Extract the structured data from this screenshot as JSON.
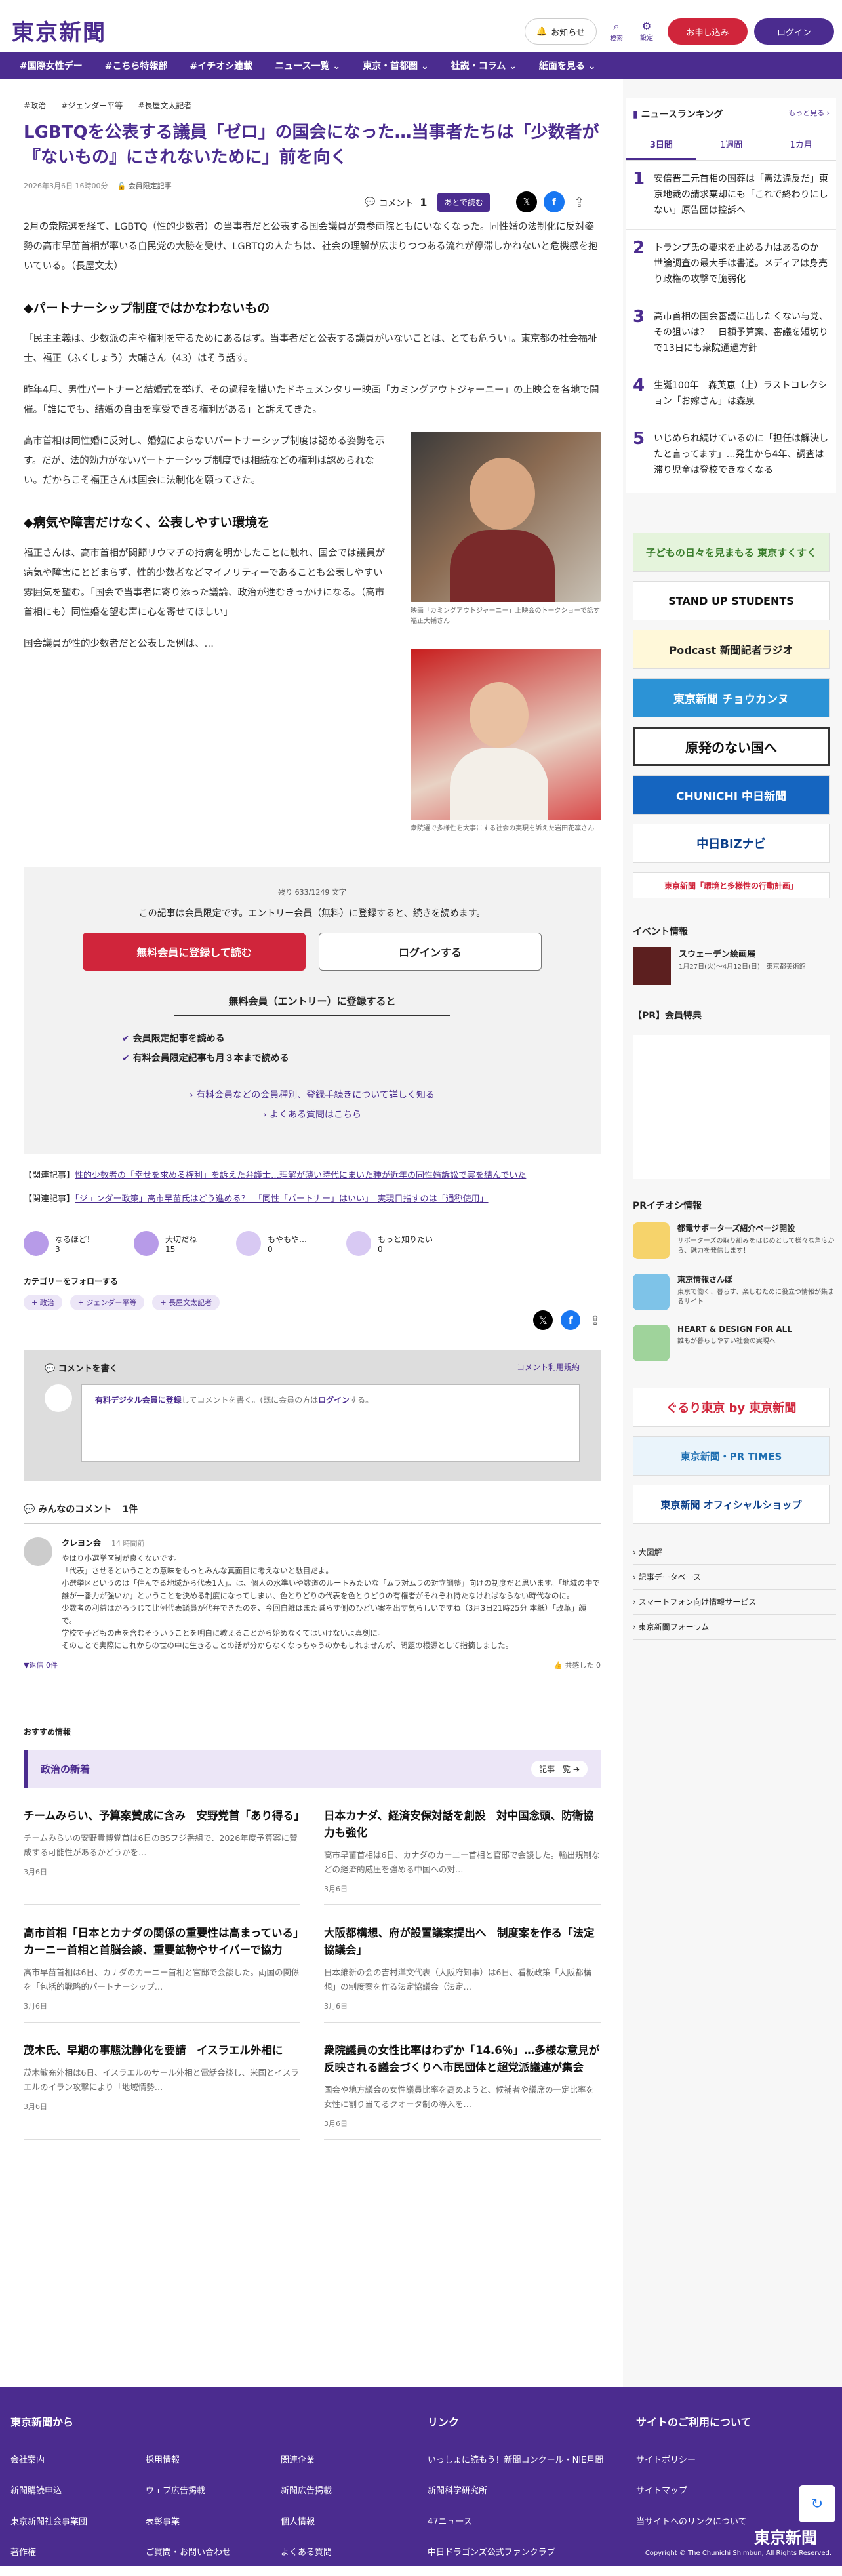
{
  "header": {
    "logo": "東京新聞",
    "notice_btn": "お知らせ",
    "search_label": "検索",
    "settings_label": "設定",
    "apply_btn": "お申し込み",
    "login_btn": "ログイン"
  },
  "nav": [
    "#国際女性デー",
    "#こちら特報部",
    "#イチオシ連載",
    "ニュース一覧 ⌄",
    "東京・首都圏 ⌄",
    "社説・コラム ⌄",
    "紙面を見る ⌄"
  ],
  "article": {
    "tags": [
      "政治",
      "ジェンダー平等",
      "長屋文太記者"
    ],
    "title": "LGBTQを公表する議員「ゼロ」の国会になった…当事者たちは「少数者が『ないもの』にされないために」前を向く",
    "date": "2026年3月6日 16時00分",
    "member_badge": "会員限定記事",
    "comment_label": "コメント",
    "comment_count": "1",
    "read_later": "あとで読む",
    "lead": "2月の衆院選を経て、LGBTQ（性的少数者）の当事者だと公表する国会議員が衆参両院ともにいなくなった。同性婚の法制化に反対姿勢の高市早苗首相が率いる自民党の大勝を受け、LGBTQの人たちは、社会の理解が広まりつつある流れが停滞しかねないと危機感を抱いている。（長屋文太）",
    "h2_1": "◆パートナーシップ制度ではかなわないもの",
    "p1": "「民主主義は、少数派の声や権利を守るためにあるはず。当事者だと公表する議員がいないことは、とても危うい」。東京都の社会福祉士、福正（ふくしょう）大輔さん（43）はそう話す。",
    "p2": "昨年4月、男性パートナーと結婚式を挙げ、その過程を描いたドキュメンタリー映画「カミングアウトジャーニー」の上映会を各地で開催。「誰にでも、結婚の自由を享受できる権利がある」と訴えてきた。",
    "p3": "高市首相は同性婚に反対し、婚姻によらないパートナーシップ制度は認める姿勢を示す。だが、法的効力がないパートナーシップ制度では相続などの権利は認められない。だからこそ福正さんは国会に法制化を願ってきた。",
    "h2_2": "◆病気や障害だけなく、公表しやすい環境を",
    "p4": "福正さんは、高市首相が関節リウマチの持病を明かしたことに触れ、国会では議員が病気や障害にとどまらず、性的少数者などマイノリティーであることも公表しやすい雰囲気を望む。「国会で当事者に寄り添った議論、政治が進むきっかけになる。（高市首相にも）同性婚を望む声に心を寄せてほしい」",
    "p5": "国会議員が性的少数者だと公表した例は、…",
    "cap1": "映画「カミングアウトジャーニー」上映会のトークショーで話す福正大輔さん",
    "cap2": "衆院選で多様性を大事にする社会の実現を訴えた岩田花凛さん",
    "remaining": "残り 633/1249 文字",
    "paywall_msg": "この記事は会員限定です。エントリー会員（無料）に登録すると、続きを読めます。",
    "register_btn": "無料会員に登録して読む",
    "login_read_btn": "ログインする",
    "entry_title": "無料会員（エントリー）に登録すると",
    "benefits": [
      "会員限定記事を読める",
      "有料会員限定記事も月３本まで読める"
    ],
    "more_link": "有料会員などの会員種別、登録手続きについて詳しく知る",
    "faq_link": "よくある質問はこちら",
    "related1_label": "【関連記事】",
    "related1": "性的少数者の「幸せを求める権利」を訴えた弁護士…理解が薄い時代にまいた種が近年の同性婚訴訟で実を結んでいた",
    "related2_label": "【関連記事】",
    "related2": "「ジェンダー政策」高市早苗氏はどう進める？　「同性「パートナー」はいい」　実現目指すのは「通称使用」",
    "reactions": [
      {
        "label": "なるほど！",
        "count": "3"
      },
      {
        "label": "大切だね",
        "count": "15"
      },
      {
        "label": "もやもや…",
        "count": "0"
      },
      {
        "label": "もっと知りたい",
        "count": "0"
      }
    ],
    "follow_label": "カテゴリーをフォローする",
    "follow_tags": [
      "政治",
      "ジェンダー平等",
      "長屋文太記者"
    ]
  },
  "comments": {
    "write_title": "コメントを書く",
    "policy": "コメント利用規約",
    "login_prompt_link": "有料デジタル会員に登録",
    "login_prompt_text": "してコメントを書く。(既に会員の方は",
    "login_prompt_login": "ログイン",
    "login_prompt_end": "する。",
    "all_title": "みんなのコメント",
    "all_count": "1件",
    "items": [
      {
        "user": "クレヨン会",
        "time": "14 時間前",
        "text": "やはり小選挙区制が良くないです。\n「代表」させるということの意味をもっとみんな真面目に考えないと駄目だよ。\n小選挙区というのは「住んでる地域から代表1人」。は、個人の水準いや数道のルートみたいな「ムラ対ムラの対立調整」向けの制度だと思います。「地域の中で誰が一番力が強いか」ということを決める制度になってしまい、色とりどりの代表を色とりどりの有権者がそれぞれ持たなければならない時代なのに。\n少数者の利益はかろうじて比例代表議員が代弁できたのを、今回自維はまた減らす側のひどい案を出す気らしいですね（3月3日21時25分 本紙）「改革」顔で。\n学校で子どもの声を含むそういうことを明白に教えることから始めなくてはいけないよ真剣に。\nそのことで実際にこれからの世の中に生きることの話が分からなくなっちゃうのかもしれませんが、問題の根源として指摘しました。",
        "reply": "返信",
        "reply_count": "0件",
        "like": "共感した",
        "like_count": "0"
      }
    ]
  },
  "recommend_label": "おすすめ情報",
  "politics": {
    "title": "政治の新着",
    "more": "記事一覧",
    "items": [
      {
        "title": "チームみらい、予算案賛成に含み　安野党首「あり得る」",
        "text": "チームみらいの安野貴博党首は6日のBSフジ番組で、2026年度予算案に賛成する可能性があるかどうかを…",
        "date": "3月6日"
      },
      {
        "title": "日本カナダ、経済安保対話を創設　対中国念頭、防衛協力も強化",
        "text": "高市早苗首相は6日、カナダのカーニー首相と官邸で会談した。輸出規制などの経済的威圧を強める中国への対…",
        "date": "3月6日"
      },
      {
        "title": "高市首相「日本とカナダの関係の重要性は高まっている」カーニー首相と首脳会談、重要鉱物やサイバーで協力",
        "text": "高市早苗首相は6日、カナダのカーニー首相と官邸で会談した。両国の関係を「包括的戦略的パートナーシップ…",
        "date": "3月6日"
      },
      {
        "title": "大阪都構想、府が設置議案提出へ　制度案を作る「法定協議会」",
        "text": "日本維新の会の吉村洋文代表（大阪府知事）は6日、看板政策「大阪都構想」の制度案を作る法定協議会（法定…",
        "date": "3月6日"
      },
      {
        "title": "茂木氏、早期の事態沈静化を要請　イスラエル外相に",
        "text": "茂木敏充外相は6日、イスラエルのサール外相と電話会談し、米国とイスラエルのイラン攻撃により「地域情勢…",
        "date": "3月6日"
      },
      {
        "title": "衆院議員の女性比率はわずか「14.6％」…多様な意見が反映される議会づくりへ市民団体と超党派議連が集会",
        "text": "国会や地方議会の女性議員比率を高めようと、候補者や議席の一定比率を女性に割り当てるクオータ制の導入を…",
        "date": "3月6日"
      }
    ]
  },
  "ranking": {
    "title": "ニュースランキング",
    "more": "もっと見る",
    "tabs": [
      "3日間",
      "1週間",
      "1カ月"
    ],
    "items": [
      {
        "num": "1",
        "text": "安倍晋三元首相の国葬は「憲法違反だ」東京地裁の請求棄却にも「これで終わりにしない」原告団は控訴へ"
      },
      {
        "num": "2",
        "text": "トランプ氏の要求を止める力はあるのか　世論調査の最大手は書道。メディアは身売り政権の攻撃で脆弱化"
      },
      {
        "num": "3",
        "text": "高市首相の国会審議に出したくない与党、その狙いは？　日額予算案、審議を短切りで13日にも衆院通過方針"
      },
      {
        "num": "4",
        "text": "生誕100年　森英恵（上）ラストコレクション「お嫁さん」は森泉"
      },
      {
        "num": "5",
        "text": "いじめられ続けているのに「担任は解決したと言ってます」…発生から4年、調査は滞り児童は登校できなくなる"
      }
    ]
  },
  "banners": [
    "子どもの日々を見まもる 東京すくすく",
    "STAND UP STUDENTS",
    "Podcast 新聞記者ラジオ",
    "東京新聞 チョウカンヌ",
    "原発のない国へ",
    "CHUNICHI 中日新聞",
    "中日BIZナビ",
    "東京新聞「環境と多様性の行動計画」"
  ],
  "event": {
    "title": "イベント情報",
    "name": "スウェーデン絵画展",
    "desc": "1月27日(火)〜4月12日(日)　東京都美術館",
    "pr": "【PR】会員特典"
  },
  "pr_info": {
    "title": "PRイチオシ情報",
    "items": [
      {
        "title": "都電サポーターズ紹介ページ開設",
        "text": "サポーターズの取り組みをはじめとして様々な角度から、魅力を発信します！"
      },
      {
        "title": "東京情報さんぽ",
        "text": "東京で働く、暮らす、楽しむために役立つ情報が集まるサイト"
      },
      {
        "title": "HEART & DESIGN FOR ALL",
        "text": "誰もが暮らしやすい社会の実現へ"
      }
    ]
  },
  "side_banners2": [
    "ぐるり東京 by 東京新聞",
    "東京新聞・PR TIMES",
    "東京新聞 オフィシャルショップ"
  ],
  "side_links": [
    "大図解",
    "記事データベース",
    "スマートフォン向け情報サービス",
    "東京新聞フォーラム"
  ],
  "footer": {
    "col1_title": "東京新聞から",
    "col1": [
      "会社案内",
      "新聞購読申込",
      "東京新聞社会事業団",
      "著作権"
    ],
    "col1b": [
      "採用情報",
      "ウェブ広告掲載",
      "表彰事業",
      "ご質問・お問い合わせ"
    ],
    "col1c": [
      "関連企業",
      "新聞広告掲載",
      "個人情報",
      "よくある質問"
    ],
    "col2_title": "リンク",
    "col2": [
      "いっしょに読もう！新聞コンクール・NIE月間",
      "新聞科学研究所",
      "47ニュース",
      "中日ドラゴンズ公式ファンクラブ"
    ],
    "col3_title": "サイトのご利用について",
    "col3": [
      "サイトポリシー",
      "サイトマップ",
      "当サイトへのリンクについて"
    ],
    "logo": "東京新聞",
    "copyright": "Copyright © The Chunichi Shimbun, All Rights Reserved."
  }
}
